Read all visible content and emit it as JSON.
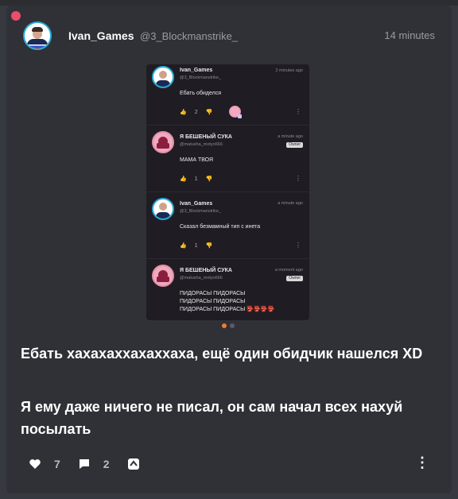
{
  "post": {
    "username": "Ivan_Games",
    "handle": "@3_Blockmanstrike_",
    "time": "14 minutes",
    "title": "Ебать хахахаххахаххаха, ещё один обидчик нашелся XD",
    "body": "Я ему даже ничего не писал, он сам начал всех нахуй посылать",
    "likes": "7",
    "comments": "2"
  },
  "screenshot": {
    "messages": [
      {
        "name": "Ivan_Games",
        "handle": "@3_Blockmanstrike_",
        "time": "2 minutes ago",
        "owner": "",
        "text": "Ебать обиделся",
        "likes": "2"
      },
      {
        "name": "Я БЕШЕНЫЙ СУКА",
        "handle": "@matusha_motyo666",
        "time": "a minute ago",
        "owner": "Owner",
        "text": "МАМА ТВОЯ",
        "likes": "1"
      },
      {
        "name": "Ivan_Games",
        "handle": "@3_Blockmanstrike_",
        "time": "a minute ago",
        "owner": "",
        "text": "Сказал безмамный тип с инета",
        "likes": "1"
      },
      {
        "name": "Я БЕШЕНЫЙ СУКА",
        "handle": "@matusha_motyo666",
        "time": "a moment ago",
        "owner": "Owner",
        "text": "ПИДОРАСЫ ПИДОРАСЫ\nПИДОРАСЫ ПИДОРАСЫ\nПИДОРАСЫ ПИДОРАСЫ 👺👺👺👺",
        "likes": ""
      }
    ],
    "pager": {
      "current": 1,
      "total": 2
    }
  },
  "colors": {
    "accent": "#f07b34",
    "notification": "#ec4d6d",
    "background": "#2f3136"
  },
  "icons": [
    "heart-icon",
    "comment-icon",
    "share-icon",
    "more-vertical-icon"
  ]
}
